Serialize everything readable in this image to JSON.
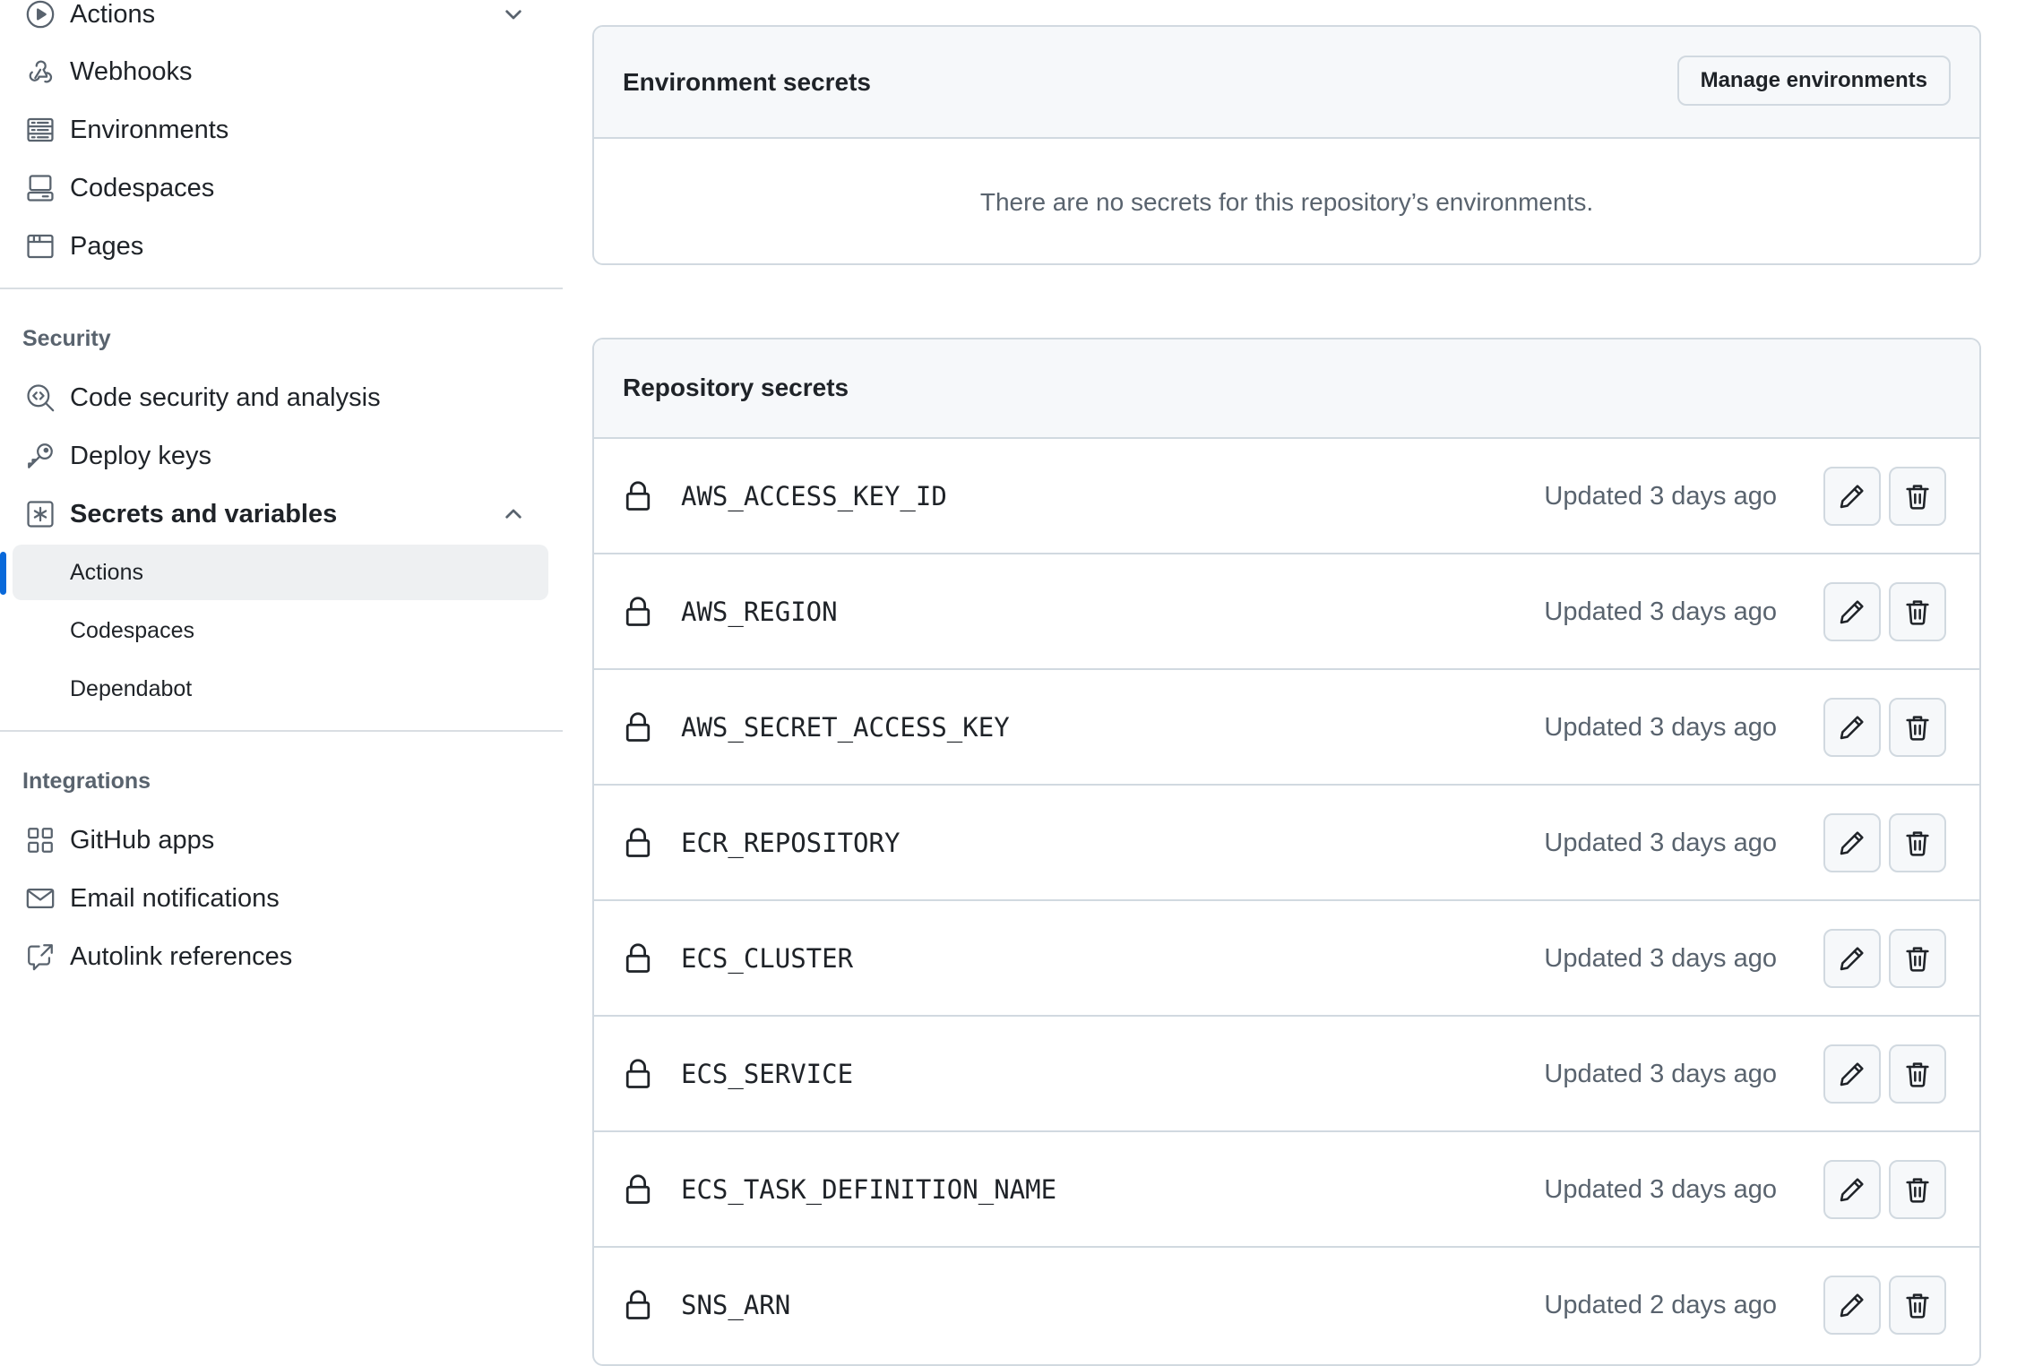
{
  "sidebar": {
    "top_items": [
      {
        "label": "Actions",
        "icon": "play-circle-icon"
      },
      {
        "label": "Webhooks",
        "icon": "webhook-icon"
      },
      {
        "label": "Environments",
        "icon": "server-icon"
      },
      {
        "label": "Codespaces",
        "icon": "codespaces-icon"
      },
      {
        "label": "Pages",
        "icon": "browser-icon"
      }
    ],
    "security": {
      "heading": "Security",
      "items": [
        {
          "label": "Code security and analysis",
          "icon": "codescan-icon"
        },
        {
          "label": "Deploy keys",
          "icon": "key-icon"
        },
        {
          "label": "Secrets and variables",
          "icon": "key-asterisk-icon"
        }
      ],
      "sub_items": [
        {
          "label": "Actions",
          "active": true
        },
        {
          "label": "Codespaces",
          "active": false
        },
        {
          "label": "Dependabot",
          "active": false
        }
      ]
    },
    "integrations": {
      "heading": "Integrations",
      "items": [
        {
          "label": "GitHub apps",
          "icon": "apps-icon"
        },
        {
          "label": "Email notifications",
          "icon": "mail-icon"
        },
        {
          "label": "Autolink references",
          "icon": "cross-reference-icon"
        }
      ]
    }
  },
  "environment_secrets": {
    "title": "Environment secrets",
    "manage_button": "Manage environments",
    "empty_message": "There are no secrets for this repository’s environments."
  },
  "repository_secrets": {
    "title": "Repository secrets",
    "items": [
      {
        "name": "AWS_ACCESS_KEY_ID",
        "updated": "Updated 3 days ago"
      },
      {
        "name": "AWS_REGION",
        "updated": "Updated 3 days ago"
      },
      {
        "name": "AWS_SECRET_ACCESS_KEY",
        "updated": "Updated 3 days ago"
      },
      {
        "name": "ECR_REPOSITORY",
        "updated": "Updated 3 days ago"
      },
      {
        "name": "ECS_CLUSTER",
        "updated": "Updated 3 days ago"
      },
      {
        "name": "ECS_SERVICE",
        "updated": "Updated 3 days ago"
      },
      {
        "name": "ECS_TASK_DEFINITION_NAME",
        "updated": "Updated 3 days ago"
      },
      {
        "name": "SNS_ARN",
        "updated": "Updated 2 days ago"
      }
    ]
  },
  "colors": {
    "accent": "#0969da",
    "border": "#d1d9e0",
    "muted_text": "#59636e",
    "header_bg": "#f6f8fa"
  }
}
